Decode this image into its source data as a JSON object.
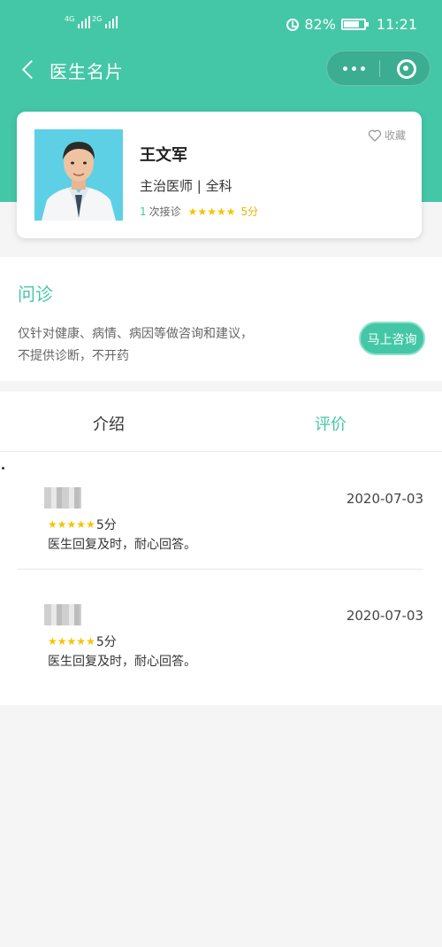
{
  "status_bar": {
    "network_1": "4G",
    "network_2": "2G",
    "battery": "82%",
    "time": "11:21"
  },
  "nav": {
    "title": "医生名片"
  },
  "doctor": {
    "name": "王文军",
    "title": "主治医师 | 全科",
    "consult_count": "1",
    "consult_suffix": "次接诊",
    "rating_stars": 5,
    "score": "5分",
    "favorite_label": "收藏"
  },
  "consult": {
    "title": "问诊",
    "desc_line1": "仅针对健康、病情、病因等做咨询和建议，",
    "desc_line2": "不提供诊断，不开药",
    "button": "马上咨询"
  },
  "tabs": [
    {
      "label": "介绍",
      "active": false
    },
    {
      "label": "评价",
      "active": true
    }
  ],
  "reviews": [
    {
      "date": "2020-07-03",
      "stars": 5,
      "score": "5分",
      "text": "医生回复及时，耐心回答。"
    },
    {
      "date": "2020-07-03",
      "stars": 5,
      "score": "5分",
      "text": "医生回复及时，耐心回答。"
    }
  ],
  "colors": {
    "accent": "#44c7a6",
    "star": "#f5c400"
  }
}
